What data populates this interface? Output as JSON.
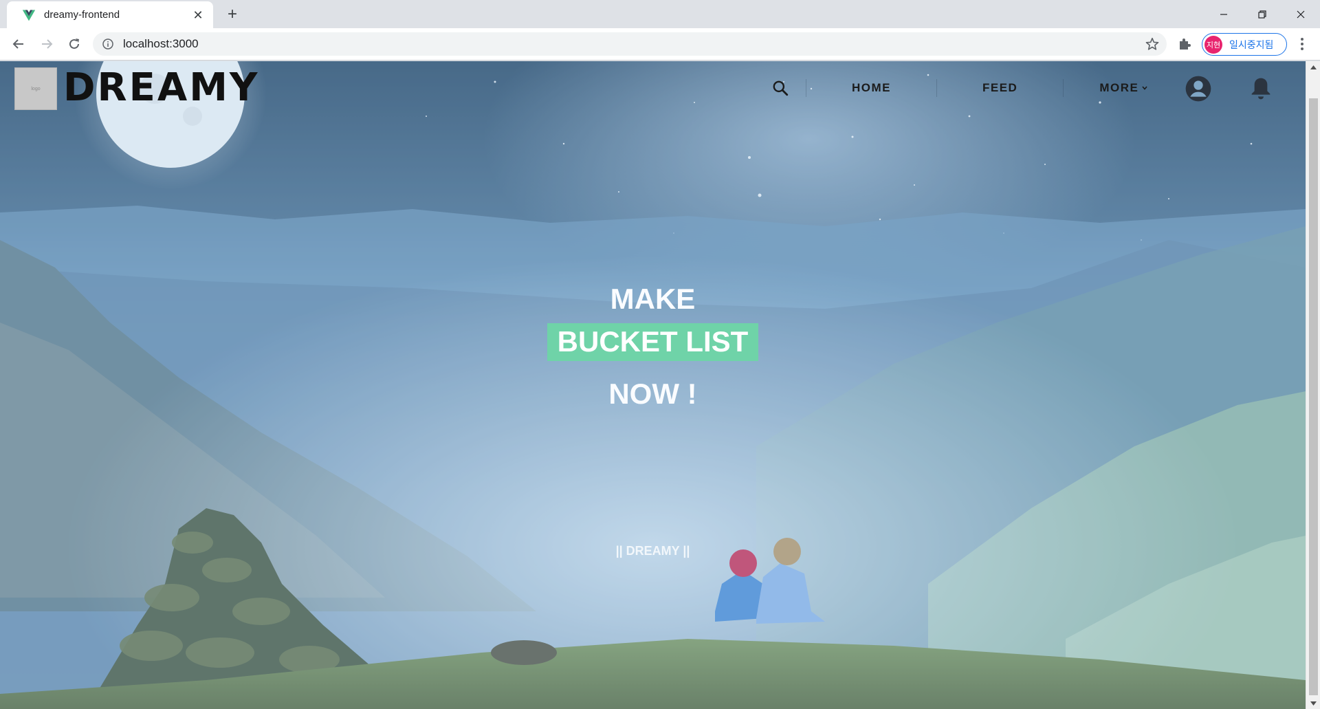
{
  "browser": {
    "tab_title": "dreamy-frontend",
    "url": "localhost:3000",
    "profile_initials": "지현",
    "profile_label": "일시중지됨"
  },
  "site": {
    "logo_text": "DREAMY",
    "logo_image_placeholder": "logo",
    "nav": {
      "home": "HOME",
      "feed": "FEED",
      "more": "MORE"
    }
  },
  "hero": {
    "line1": "MAKE",
    "line2": "BUCKET LIST",
    "line3": "NOW !",
    "footer": "|| DREAMY ||",
    "highlight_color": "#6fd3a8"
  },
  "icons": [
    "vue-logo-icon",
    "close-icon",
    "plus-icon",
    "minimize-icon",
    "restore-icon",
    "window-close-icon",
    "back-arrow-icon",
    "forward-arrow-icon",
    "reload-icon",
    "info-icon",
    "star-icon",
    "puzzle-icon",
    "kebab-menu-icon",
    "search-icon",
    "chevron-down-icon",
    "account-circle-icon",
    "bell-icon"
  ]
}
